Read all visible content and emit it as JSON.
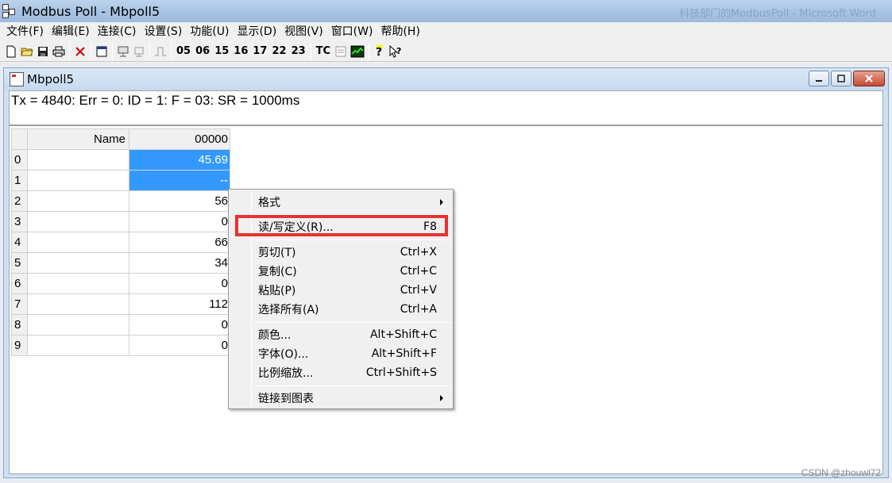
{
  "app": {
    "title": "Modbus Poll - Mbpoll5",
    "background_title": "科技部门的ModbusPoll - Microsoft Word"
  },
  "menu": [
    "文件(F)",
    "编辑(E)",
    "连接(C)",
    "设置(S)",
    "功能(U)",
    "显示(D)",
    "视图(V)",
    "窗口(W)",
    "帮助(H)"
  ],
  "toolbar": {
    "function_codes": [
      "05",
      "06",
      "15",
      "16",
      "17",
      "22",
      "23"
    ],
    "tc_label": "TC",
    "icons": [
      "new-icon",
      "open-icon",
      "save-icon",
      "print-icon",
      "delete-icon",
      "window-icon",
      "connect-icon",
      "disconnect-icon",
      "pulse-icon",
      "communication-icon",
      "chart-icon",
      "help-icon",
      "context-help-icon"
    ]
  },
  "child": {
    "title": "Mbpoll5",
    "status": "Tx = 4840: Err = 0: ID = 1: F = 03: SR = 1000ms",
    "grid": {
      "name_header": "Name",
      "col_header": "00000",
      "rows": [
        {
          "idx": "0",
          "name": "",
          "value": "45.69"
        },
        {
          "idx": "1",
          "name": "",
          "value": "--"
        },
        {
          "idx": "2",
          "name": "",
          "value": "56"
        },
        {
          "idx": "3",
          "name": "",
          "value": "0"
        },
        {
          "idx": "4",
          "name": "",
          "value": "66"
        },
        {
          "idx": "5",
          "name": "",
          "value": "34"
        },
        {
          "idx": "6",
          "name": "",
          "value": "0"
        },
        {
          "idx": "7",
          "name": "",
          "value": "112"
        },
        {
          "idx": "8",
          "name": "",
          "value": "0"
        },
        {
          "idx": "9",
          "name": "",
          "value": "0"
        }
      ]
    }
  },
  "context_menu": {
    "format": "格式",
    "read_write_def": "读/写定义(R)...",
    "read_write_key": "F8",
    "cut": "剪切(T)",
    "cut_key": "Ctrl+X",
    "copy": "复制(C)",
    "copy_key": "Ctrl+C",
    "paste": "粘贴(P)",
    "paste_key": "Ctrl+V",
    "select_all": "选择所有(A)",
    "select_all_key": "Ctrl+A",
    "color": "颜色...",
    "color_key": "Alt+Shift+C",
    "font": "字体(O)...",
    "font_key": "Alt+Shift+F",
    "zoom": "比例缩放...",
    "zoom_key": "Ctrl+Shift+S",
    "link_chart": "链接到图表"
  },
  "watermark": "CSDN @zhouwl72",
  "colors": {
    "selection": "#3399ff",
    "highlight_border": "#e8322f"
  }
}
